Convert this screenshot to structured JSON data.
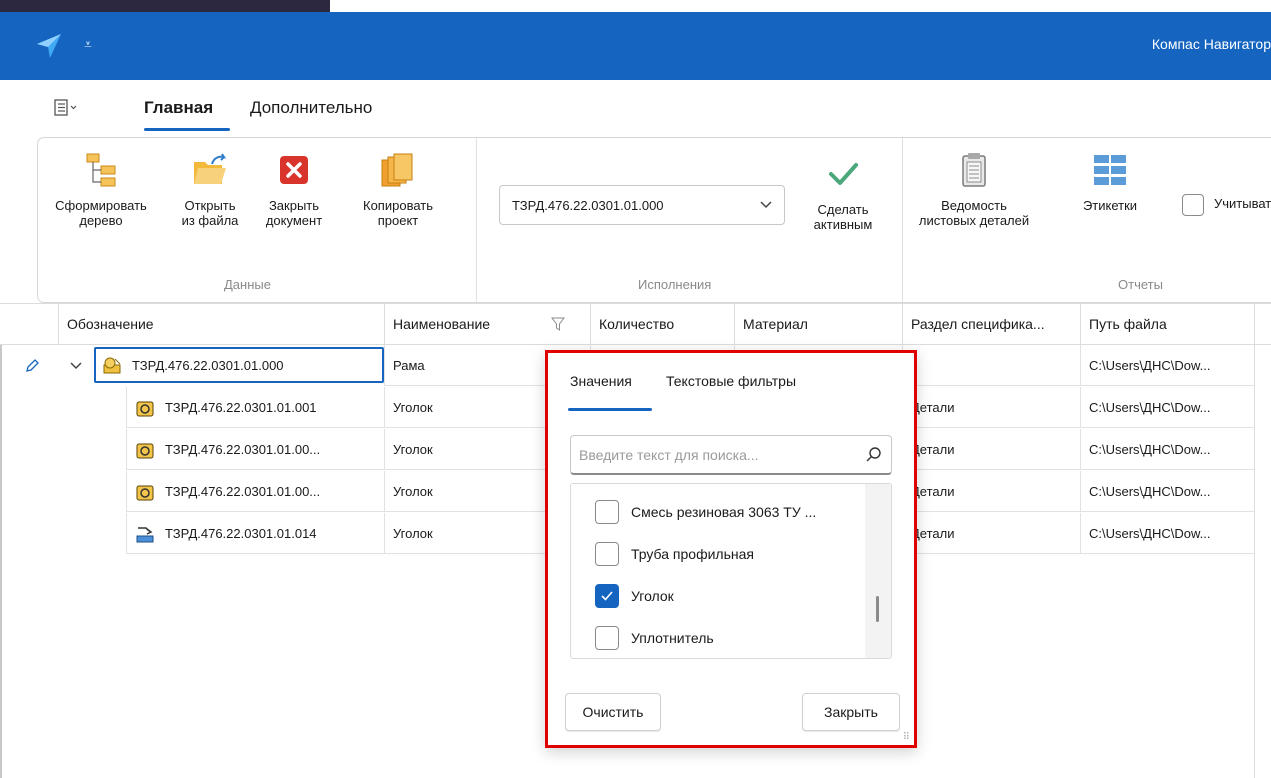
{
  "app": {
    "title": "Компас Навигатор"
  },
  "colors": {
    "accent": "#1565c0",
    "highlight_border": "#e00000"
  },
  "tabs": [
    {
      "label": "Главная",
      "active": true
    },
    {
      "label": "Дополнительно",
      "active": false
    }
  ],
  "ribbon": {
    "groups": {
      "data": "Данные",
      "versions": "Исполнения",
      "reports": "Отчеты"
    },
    "buttons": {
      "build_tree": {
        "line1": "Сформировать",
        "line2": "дерево",
        "icon": "tree-icon"
      },
      "open_file": {
        "line1": "Открыть",
        "line2": "из файла",
        "icon": "folder-open-icon"
      },
      "close_doc": {
        "line1": "Закрыть",
        "line2": "документ",
        "icon": "close-doc-icon"
      },
      "copy_project": {
        "line1": "Копировать",
        "line2": "проект",
        "icon": "copy-project-icon"
      },
      "make_active": {
        "line1": "Сделать",
        "line2": "активным",
        "icon": "checkmark-icon"
      },
      "sheet_parts": {
        "line1": "Ведомость",
        "line2": "листовых деталей",
        "icon": "clipboard-icon"
      },
      "labels": {
        "line1": "Этикетки",
        "icon": "labels-icon"
      }
    },
    "version_combo": {
      "value": "ТЗРД.476.22.0301.01.000"
    },
    "consider_checkbox": {
      "label": "Учитыват",
      "checked": false
    }
  },
  "grid": {
    "headers": [
      "Обозначение",
      "Наименование",
      "Количество",
      "Материал",
      "Раздел специфика...",
      "Путь файла"
    ],
    "rows": [
      {
        "designation": "ТЗРД.476.22.0301.01.000",
        "name": "Рама",
        "section": "",
        "path": "C:\\Users\\ДНС\\Dow...",
        "icon": "assembly-icon",
        "expanded": true,
        "selected": true
      },
      {
        "designation": "ТЗРД.476.22.0301.01.001",
        "name": "Уголок",
        "section": "Детали",
        "path": "C:\\Users\\ДНС\\Dow...",
        "icon": "part-icon"
      },
      {
        "designation": "ТЗРД.476.22.0301.01.00...",
        "name": "Уголок",
        "section": "Детали",
        "path": "C:\\Users\\ДНС\\Dow...",
        "icon": "part-icon"
      },
      {
        "designation": "ТЗРД.476.22.0301.01.00...",
        "name": "Уголок",
        "section": "Детали",
        "path": "C:\\Users\\ДНС\\Dow...",
        "icon": "part-icon"
      },
      {
        "designation": "ТЗРД.476.22.0301.01.014",
        "name": "Уголок",
        "section": "Детали",
        "path": "C:\\Users\\ДНС\\Dow...",
        "icon": "sheet-part-icon"
      }
    ]
  },
  "filter_popup": {
    "tabs": {
      "values": "Значения",
      "text_filters": "Текстовые фильтры"
    },
    "search_placeholder": "Введите текст для поиска...",
    "items": [
      {
        "label": "Смесь резиновая 3063  ТУ ...",
        "checked": false
      },
      {
        "label": "Труба профильная",
        "checked": false
      },
      {
        "label": "Уголок",
        "checked": true
      },
      {
        "label": "Уплотнитель",
        "checked": false
      }
    ],
    "clear_label": "Очистить",
    "close_label": "Закрыть"
  }
}
